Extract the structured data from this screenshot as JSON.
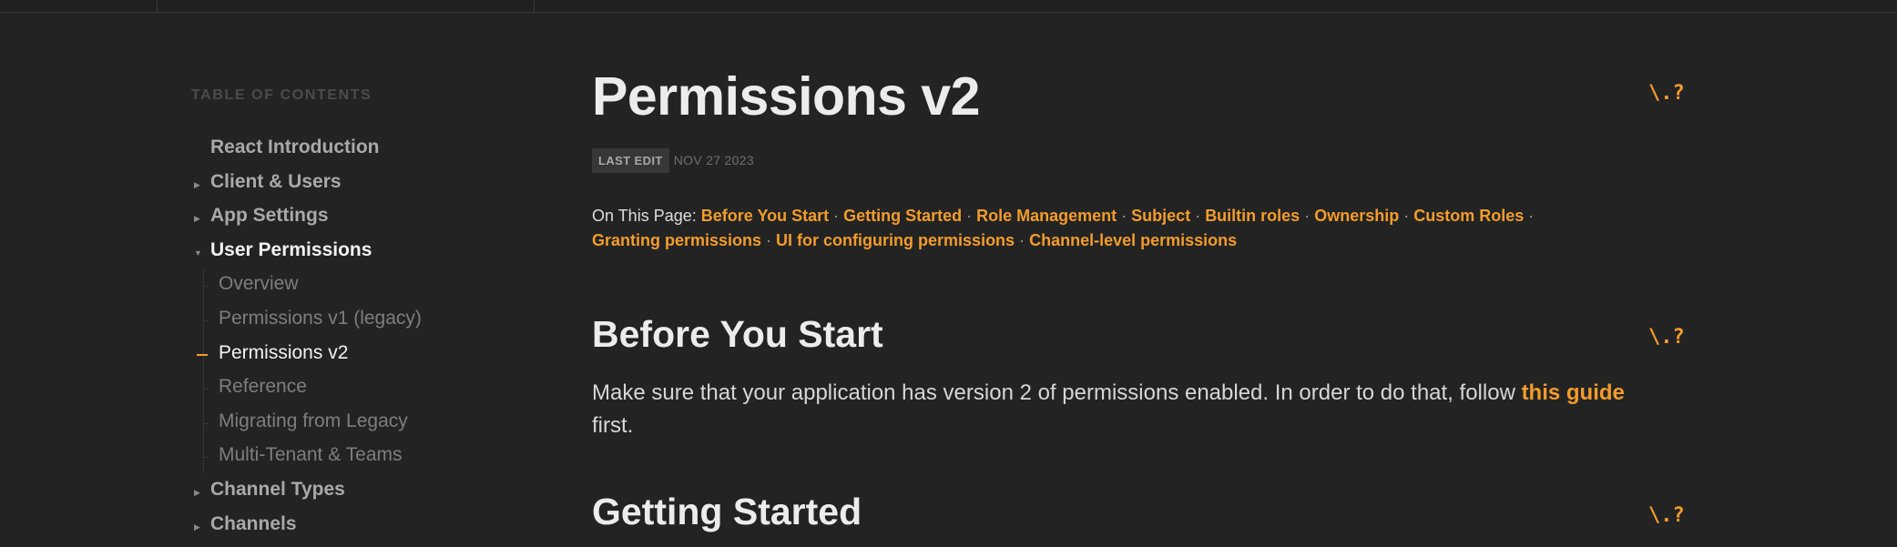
{
  "toc": {
    "heading": "TABLE OF CONTENTS",
    "items": [
      {
        "label": "React Introduction"
      },
      {
        "label": "Client & Users"
      },
      {
        "label": "App Settings"
      },
      {
        "label": "User Permissions"
      },
      {
        "label": "Channel Types"
      },
      {
        "label": "Channels"
      }
    ],
    "sub_items": [
      {
        "label": "Overview"
      },
      {
        "label": "Permissions v1 (legacy)"
      },
      {
        "label": "Permissions v2"
      },
      {
        "label": "Reference"
      },
      {
        "label": "Migrating from Legacy"
      },
      {
        "label": "Multi-Tenant & Teams"
      }
    ],
    "active_item": "Permissions v2"
  },
  "page": {
    "title": "Permissions v2",
    "last_edit_label": "LAST EDIT",
    "last_edit_date": "NOV 27 2023",
    "on_this_page_label": "On This Page:",
    "on_this_page_links": [
      "Before You Start",
      "Getting Started",
      "Role Management",
      "Subject",
      "Builtin roles",
      "Ownership",
      "Custom Roles",
      "Granting permissions",
      "UI for configuring permissions",
      "Channel-level permissions"
    ],
    "separator": "·"
  },
  "sections": {
    "before_you_start": {
      "title": "Before You Start",
      "text_before": "Make sure that your application has version 2 of permissions enabled. In order to do that, follow ",
      "link": "this guide",
      "text_after": " first."
    },
    "getting_started": {
      "title": "Getting Started"
    }
  },
  "icons": {
    "anchor": "anchor-link-icon",
    "chevron_right": "chevron-right-icon",
    "chevron_down": "chevron-down-icon"
  },
  "colors": {
    "accent": "#f29c2b",
    "background": "#232323"
  }
}
